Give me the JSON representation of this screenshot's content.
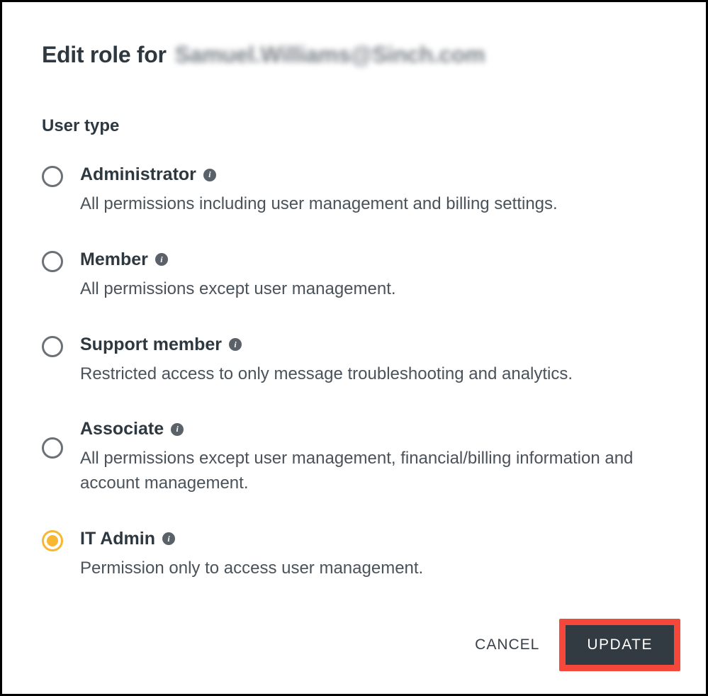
{
  "title": {
    "prefix": "Edit role for",
    "email": "Samuel.Williams@Sinch.com"
  },
  "section_label": "User type",
  "options": [
    {
      "id": "administrator",
      "title": "Administrator",
      "description": "All permissions including user management and billing settings.",
      "selected": false
    },
    {
      "id": "member",
      "title": "Member",
      "description": "All permissions except user management.",
      "selected": false
    },
    {
      "id": "support-member",
      "title": "Support member",
      "description": "Restricted access to only message troubleshooting and analytics.",
      "selected": false
    },
    {
      "id": "associate",
      "title": "Associate",
      "description": "All permissions except user management, financial/billing information and account management.",
      "selected": false
    },
    {
      "id": "it-admin",
      "title": "IT Admin",
      "description": "Permission only to access user management.",
      "selected": true
    }
  ],
  "actions": {
    "cancel": "CANCEL",
    "update": "UPDATE"
  }
}
